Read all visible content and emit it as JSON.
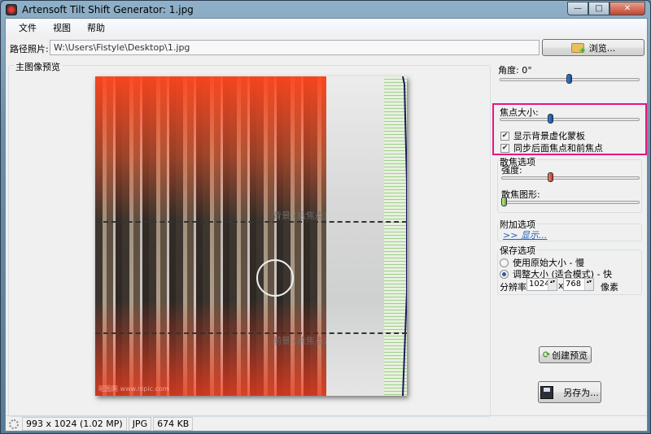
{
  "window": {
    "title": "Artensoft Tilt Shift Generator: 1.jpg",
    "minimize": "—",
    "maximize": "□",
    "close": "✕"
  },
  "menu": [
    "文件",
    "视图",
    "帮助"
  ],
  "path": {
    "label": "路径照片:",
    "value": "W:\\Users\\Fistyle\\Desktop\\1.jpg",
    "browse": "浏览..."
  },
  "preview": {
    "title": "主图像预览",
    "back_label": "背景 (后焦点)",
    "front_label": "前景 (前焦点)",
    "watermark": "昵图网 www.nipic.com"
  },
  "controls": {
    "angle_label": "角度: 0°",
    "angle_value": 0.5,
    "focus_label": "焦点大小:",
    "focus_value": 0.4,
    "show_mask": "显示背景虚化蒙板",
    "show_mask_checked": true,
    "sync_focus": "同步后面焦点和前焦点",
    "sync_focus_checked": true,
    "bokeh_title": "散焦选项",
    "strength_label": "强度:",
    "strength_value": 0.4,
    "shape_label": "散焦图形:",
    "shape_value": 0,
    "extra_title": "附加选项",
    "extra_link": ">> 显示...",
    "save_title": "保存选项",
    "opt_original": "使用原始大小 - 慢",
    "opt_resize": "调整大小 (适合模式) - 快",
    "resolution_label": "分辨率",
    "res_w": "1024",
    "res_x": "x",
    "res_h": "768",
    "res_unit": "像素",
    "create_preview": "创建预览",
    "save_as": "另存为..."
  },
  "status": {
    "dims": "993 x 1024 (1.02 MP)",
    "format": "JPG",
    "size": "674 KB"
  },
  "colors": {
    "highlight": "#e8167d"
  }
}
